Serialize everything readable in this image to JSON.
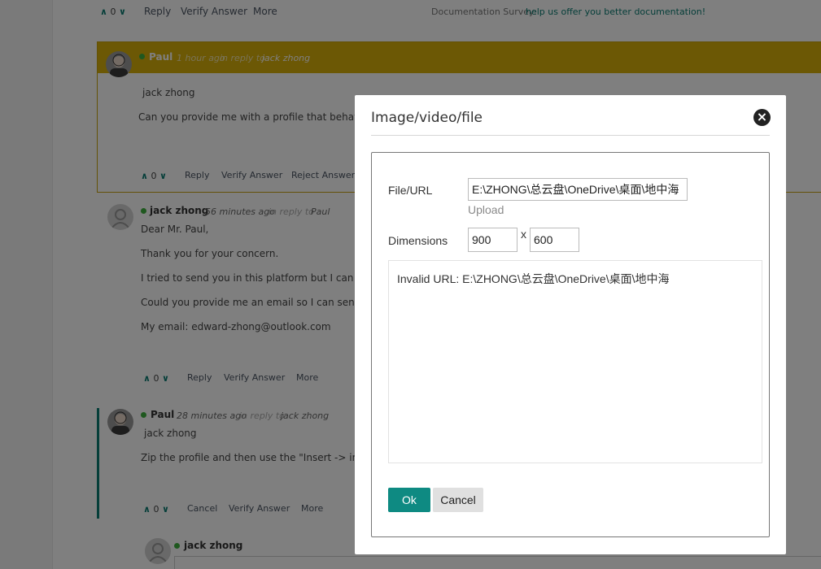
{
  "thread": {
    "top_actions": {
      "votes": "0",
      "reply": "Reply",
      "verify": "Verify Answer",
      "more": "More"
    },
    "survey": {
      "prefix": "Documentation Survey:",
      "link": "help us offer you better documentation!"
    },
    "comment1": {
      "author": "Paul",
      "time": "1 hour ago",
      "reply_to_prefix": "in reply to",
      "reply_to": "jack zhong",
      "mention": "jack zhong",
      "body": "Can you provide me with a profile that behaves",
      "actions": {
        "votes": "0",
        "reply": "Reply",
        "verify": "Verify Answer",
        "reject": "Reject Answer"
      }
    },
    "comment2": {
      "author": "jack zhong",
      "time": "56 minutes ago",
      "reply_to_prefix": "in reply to",
      "reply_to": "Paul",
      "lines": [
        "Dear Mr. Paul,",
        "Thank you for your concern.",
        "I tried to send you in this platform but I can no",
        "Could you provide me an email so I can send y",
        "My email: edward-zhong@outlook.com"
      ],
      "actions": {
        "votes": "0",
        "reply": "Reply",
        "verify": "Verify Answer",
        "more": "More"
      }
    },
    "comment3": {
      "author": "Paul",
      "time": "28 minutes ago",
      "reply_to_prefix": "in reply to",
      "reply_to": "jack zhong",
      "mention": "jack zhong",
      "body": "Zip the profile and then use the \"Insert -> imag",
      "actions": {
        "votes": "0",
        "cancel": "Cancel",
        "verify": "Verify Answer",
        "more": "More"
      }
    },
    "comment4": {
      "author": "jack zhong"
    }
  },
  "dialog": {
    "title": "Image/video/file",
    "file_url_label": "File/URL",
    "file_url_value": "E:\\ZHONG\\总云盘\\OneDrive\\桌面\\地中海",
    "upload_label": "Upload",
    "dimensions_label": "Dimensions",
    "width": "900",
    "times": "x",
    "height": "600",
    "preview_message": "Invalid URL: E:\\ZHONG\\总云盘\\OneDrive\\桌面\\地中海",
    "ok_label": "Ok",
    "cancel_label": "Cancel",
    "close_icon": "×"
  },
  "icons": {
    "up": "∧",
    "down": "∨"
  },
  "colors": {
    "accent": "#0e8a82",
    "highlight": "#d9b00a",
    "online": "#3fb13f"
  }
}
